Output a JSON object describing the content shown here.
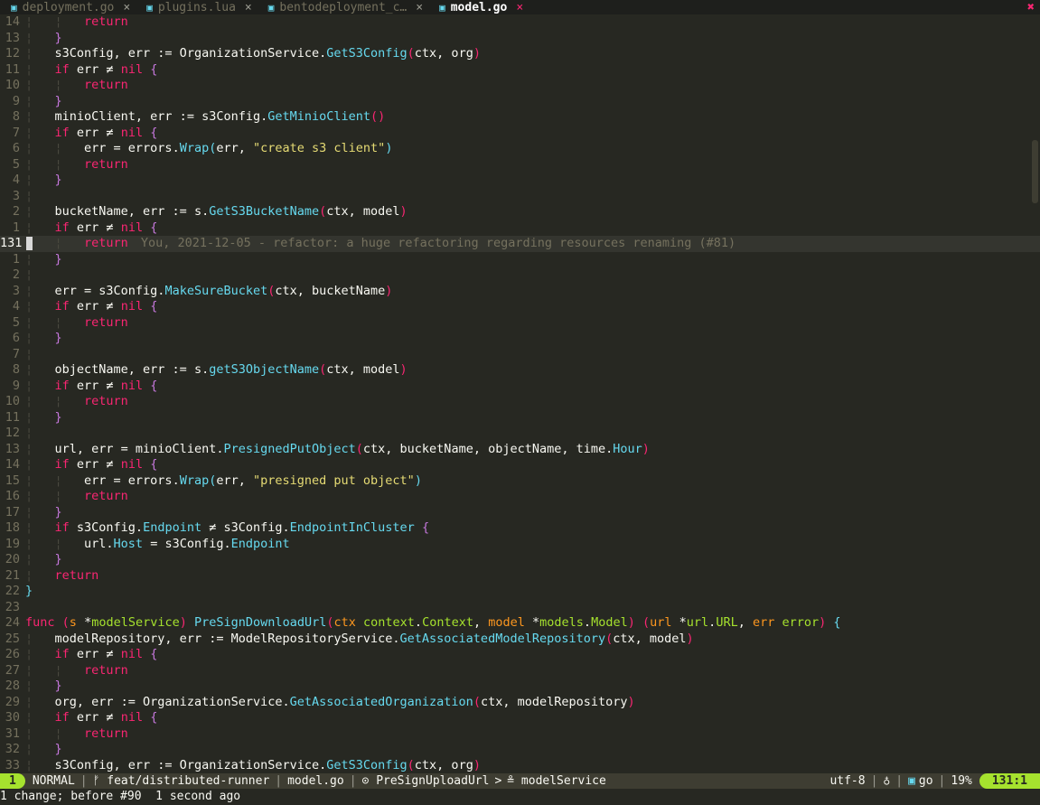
{
  "tabs": [
    {
      "name": "deployment.go",
      "active": false
    },
    {
      "name": "plugins.lua",
      "active": false
    },
    {
      "name": "bentodeployment_c…",
      "active": false
    },
    {
      "name": "model.go",
      "active": true
    }
  ],
  "tab_close_glyph": "×",
  "tabline_close_all": "✖",
  "cursor_line_index": 17,
  "blame_text": "You, 2021-12-05 - refactor: a huge refactoring regarding resources renaming (#81)",
  "lines": [
    {
      "n": "14",
      "t": [
        [
          "ind",
          "¦   ¦   "
        ],
        [
          "kw",
          "return"
        ]
      ]
    },
    {
      "n": "13",
      "t": [
        [
          "ind",
          "¦   "
        ],
        [
          "p2",
          "}"
        ]
      ]
    },
    {
      "n": "12",
      "t": [
        [
          "ind",
          "¦   "
        ],
        [
          "",
          "s3Config, err := OrganizationService."
        ],
        [
          "fn",
          "GetS3Config"
        ],
        [
          "p1",
          "("
        ],
        [
          "",
          "ctx, org"
        ],
        [
          "p1",
          ")"
        ]
      ]
    },
    {
      "n": "11",
      "t": [
        [
          "ind",
          "¦   "
        ],
        [
          "kw",
          "if"
        ],
        [
          "",
          " err ≠ "
        ],
        [
          "kw",
          "nil"
        ],
        [
          "",
          " "
        ],
        [
          "p2",
          "{"
        ]
      ]
    },
    {
      "n": "10",
      "t": [
        [
          "ind",
          "¦   ¦   "
        ],
        [
          "kw",
          "return"
        ]
      ]
    },
    {
      "n": "9",
      "t": [
        [
          "ind",
          "¦   "
        ],
        [
          "p2",
          "}"
        ]
      ]
    },
    {
      "n": "8",
      "t": [
        [
          "ind",
          "¦   "
        ],
        [
          "",
          "minioClient, err := s3Config."
        ],
        [
          "fn",
          "GetMinioClient"
        ],
        [
          "p1",
          "()"
        ]
      ]
    },
    {
      "n": "7",
      "t": [
        [
          "ind",
          "¦   "
        ],
        [
          "kw",
          "if"
        ],
        [
          "",
          " err ≠ "
        ],
        [
          "kw",
          "nil"
        ],
        [
          "",
          " "
        ],
        [
          "p2",
          "{"
        ]
      ]
    },
    {
      "n": "6",
      "t": [
        [
          "ind",
          "¦   ¦   "
        ],
        [
          "",
          "err = errors."
        ],
        [
          "fn",
          "Wrap"
        ],
        [
          "p3",
          "("
        ],
        [
          "",
          "err, "
        ],
        [
          "str",
          "\"create s3 client\""
        ],
        [
          "p3",
          ")"
        ]
      ]
    },
    {
      "n": "5",
      "t": [
        [
          "ind",
          "¦   ¦   "
        ],
        [
          "kw",
          "return"
        ]
      ]
    },
    {
      "n": "4",
      "t": [
        [
          "ind",
          "¦   "
        ],
        [
          "p2",
          "}"
        ]
      ]
    },
    {
      "n": "3",
      "t": [
        [
          "ind",
          "¦   "
        ]
      ]
    },
    {
      "n": "2",
      "t": [
        [
          "ind",
          "¦   "
        ],
        [
          "",
          "bucketName, err := s."
        ],
        [
          "fn",
          "GetS3BucketName"
        ],
        [
          "p1",
          "("
        ],
        [
          "",
          "ctx, model"
        ],
        [
          "p1",
          ")"
        ]
      ]
    },
    {
      "n": "1",
      "t": [
        [
          "ind",
          "¦   "
        ],
        [
          "kw",
          "if"
        ],
        [
          "",
          " err ≠ "
        ],
        [
          "kw",
          "nil"
        ],
        [
          "",
          " "
        ],
        [
          "p2",
          "{"
        ]
      ]
    },
    {
      "n": "131",
      "t": [
        [
          "ind",
          "¦   ¦   "
        ],
        [
          "kw",
          "return"
        ]
      ]
    },
    {
      "n": "1",
      "t": [
        [
          "ind",
          "¦   "
        ],
        [
          "p2",
          "}"
        ]
      ]
    },
    {
      "n": "2",
      "t": [
        [
          "ind",
          "¦   "
        ]
      ]
    },
    {
      "n": "3",
      "t": [
        [
          "ind",
          "¦   "
        ],
        [
          "",
          "err = s3Config."
        ],
        [
          "fn",
          "MakeSureBucket"
        ],
        [
          "p1",
          "("
        ],
        [
          "",
          "ctx, bucketName"
        ],
        [
          "p1",
          ")"
        ]
      ]
    },
    {
      "n": "4",
      "t": [
        [
          "ind",
          "¦   "
        ],
        [
          "kw",
          "if"
        ],
        [
          "",
          " err ≠ "
        ],
        [
          "kw",
          "nil"
        ],
        [
          "",
          " "
        ],
        [
          "p2",
          "{"
        ]
      ]
    },
    {
      "n": "5",
      "t": [
        [
          "ind",
          "¦   ¦   "
        ],
        [
          "kw",
          "return"
        ]
      ]
    },
    {
      "n": "6",
      "t": [
        [
          "ind",
          "¦   "
        ],
        [
          "p2",
          "}"
        ]
      ]
    },
    {
      "n": "7",
      "t": [
        [
          "ind",
          "¦   "
        ]
      ]
    },
    {
      "n": "8",
      "t": [
        [
          "ind",
          "¦   "
        ],
        [
          "",
          "objectName, err := s."
        ],
        [
          "fn",
          "getS3ObjectName"
        ],
        [
          "p1",
          "("
        ],
        [
          "",
          "ctx, model"
        ],
        [
          "p1",
          ")"
        ]
      ]
    },
    {
      "n": "9",
      "t": [
        [
          "ind",
          "¦   "
        ],
        [
          "kw",
          "if"
        ],
        [
          "",
          " err ≠ "
        ],
        [
          "kw",
          "nil"
        ],
        [
          "",
          " "
        ],
        [
          "p2",
          "{"
        ]
      ]
    },
    {
      "n": "10",
      "t": [
        [
          "ind",
          "¦   ¦   "
        ],
        [
          "kw",
          "return"
        ]
      ]
    },
    {
      "n": "11",
      "t": [
        [
          "ind",
          "¦   "
        ],
        [
          "p2",
          "}"
        ]
      ]
    },
    {
      "n": "12",
      "t": [
        [
          "ind",
          "¦   "
        ]
      ]
    },
    {
      "n": "13",
      "t": [
        [
          "ind",
          "¦   "
        ],
        [
          "",
          "url, err = minioClient."
        ],
        [
          "fn",
          "PresignedPutObject"
        ],
        [
          "p1",
          "("
        ],
        [
          "",
          "ctx, bucketName, objectName, time."
        ],
        [
          "fn",
          "Hour"
        ],
        [
          "p1",
          ")"
        ]
      ]
    },
    {
      "n": "14",
      "t": [
        [
          "ind",
          "¦   "
        ],
        [
          "kw",
          "if"
        ],
        [
          "",
          " err ≠ "
        ],
        [
          "kw",
          "nil"
        ],
        [
          "",
          " "
        ],
        [
          "p2",
          "{"
        ]
      ]
    },
    {
      "n": "15",
      "t": [
        [
          "ind",
          "¦   ¦   "
        ],
        [
          "",
          "err = errors."
        ],
        [
          "fn",
          "Wrap"
        ],
        [
          "p3",
          "("
        ],
        [
          "",
          "err, "
        ],
        [
          "str",
          "\"presigned put object\""
        ],
        [
          "p3",
          ")"
        ]
      ]
    },
    {
      "n": "16",
      "t": [
        [
          "ind",
          "¦   ¦   "
        ],
        [
          "kw",
          "return"
        ]
      ]
    },
    {
      "n": "17",
      "t": [
        [
          "ind",
          "¦   "
        ],
        [
          "p2",
          "}"
        ]
      ]
    },
    {
      "n": "18",
      "t": [
        [
          "ind",
          "¦   "
        ],
        [
          "kw",
          "if"
        ],
        [
          "",
          " s3Config."
        ],
        [
          "fn",
          "Endpoint"
        ],
        [
          "",
          " ≠ s3Config."
        ],
        [
          "fn",
          "EndpointInCluster"
        ],
        [
          "",
          " "
        ],
        [
          "p2",
          "{"
        ]
      ]
    },
    {
      "n": "19",
      "t": [
        [
          "ind",
          "¦   ¦   "
        ],
        [
          "",
          "url."
        ],
        [
          "fn",
          "Host"
        ],
        [
          "",
          " = s3Config."
        ],
        [
          "fn",
          "Endpoint"
        ]
      ]
    },
    {
      "n": "20",
      "t": [
        [
          "ind",
          "¦   "
        ],
        [
          "p2",
          "}"
        ]
      ]
    },
    {
      "n": "21",
      "t": [
        [
          "ind",
          "¦   "
        ],
        [
          "kw",
          "return"
        ]
      ]
    },
    {
      "n": "22",
      "t": [
        [
          "p3",
          "}"
        ]
      ]
    },
    {
      "n": "23",
      "t": []
    },
    {
      "n": "24",
      "t": [
        [
          "kw",
          "func"
        ],
        [
          "",
          " "
        ],
        [
          "p1",
          "("
        ],
        [
          "par",
          "s"
        ],
        [
          "",
          " *"
        ],
        [
          "typ",
          "modelService"
        ],
        [
          "p1",
          ")"
        ],
        [
          "",
          " "
        ],
        [
          "fn",
          "PreSignDownloadUrl"
        ],
        [
          "p1",
          "("
        ],
        [
          "par",
          "ctx"
        ],
        [
          "",
          " "
        ],
        [
          "typ",
          "context"
        ],
        [
          "",
          "."
        ],
        [
          "typ",
          "Context"
        ],
        [
          "",
          ", "
        ],
        [
          "par",
          "model"
        ],
        [
          "",
          " *"
        ],
        [
          "typ",
          "models"
        ],
        [
          "",
          "."
        ],
        [
          "typ",
          "Model"
        ],
        [
          "p1",
          ")"
        ],
        [
          "",
          " "
        ],
        [
          "p1",
          "("
        ],
        [
          "par",
          "url"
        ],
        [
          "",
          " *"
        ],
        [
          "typ",
          "url"
        ],
        [
          "",
          "."
        ],
        [
          "typ",
          "URL"
        ],
        [
          "",
          ", "
        ],
        [
          "par",
          "err"
        ],
        [
          "",
          " "
        ],
        [
          "typ",
          "error"
        ],
        [
          "p1",
          ")"
        ],
        [
          "",
          " "
        ],
        [
          "p3",
          "{"
        ]
      ]
    },
    {
      "n": "25",
      "t": [
        [
          "ind",
          "¦   "
        ],
        [
          "",
          "modelRepository, err := ModelRepositoryService."
        ],
        [
          "fn",
          "GetAssociatedModelRepository"
        ],
        [
          "p1",
          "("
        ],
        [
          "",
          "ctx, model"
        ],
        [
          "p1",
          ")"
        ]
      ]
    },
    {
      "n": "26",
      "t": [
        [
          "ind",
          "¦   "
        ],
        [
          "kw",
          "if"
        ],
        [
          "",
          " err ≠ "
        ],
        [
          "kw",
          "nil"
        ],
        [
          "",
          " "
        ],
        [
          "p2",
          "{"
        ]
      ]
    },
    {
      "n": "27",
      "t": [
        [
          "ind",
          "¦   ¦   "
        ],
        [
          "kw",
          "return"
        ]
      ]
    },
    {
      "n": "28",
      "t": [
        [
          "ind",
          "¦   "
        ],
        [
          "p2",
          "}"
        ]
      ]
    },
    {
      "n": "29",
      "t": [
        [
          "ind",
          "¦   "
        ],
        [
          "",
          "org, err := OrganizationService."
        ],
        [
          "fn",
          "GetAssociatedOrganization"
        ],
        [
          "p1",
          "("
        ],
        [
          "",
          "ctx, modelRepository"
        ],
        [
          "p1",
          ")"
        ]
      ]
    },
    {
      "n": "30",
      "t": [
        [
          "ind",
          "¦   "
        ],
        [
          "kw",
          "if"
        ],
        [
          "",
          " err ≠ "
        ],
        [
          "kw",
          "nil"
        ],
        [
          "",
          " "
        ],
        [
          "p2",
          "{"
        ]
      ]
    },
    {
      "n": "31",
      "t": [
        [
          "ind",
          "¦   ¦   "
        ],
        [
          "kw",
          "return"
        ]
      ]
    },
    {
      "n": "32",
      "t": [
        [
          "ind",
          "¦   "
        ],
        [
          "p2",
          "}"
        ]
      ]
    },
    {
      "n": "33",
      "t": [
        [
          "ind",
          "¦   "
        ],
        [
          "",
          "s3Config, err := OrganizationService."
        ],
        [
          "fn",
          "GetS3Config"
        ],
        [
          "p1",
          "("
        ],
        [
          "",
          "ctx, org"
        ],
        [
          "p1",
          ")"
        ]
      ]
    }
  ],
  "statusline": {
    "window_number": "1",
    "mode": "NORMAL",
    "branch": "ᚠ feat/distributed-runner",
    "filename": "model.go",
    "breadcrumb_func": "⊙ PreSignUploadUrl",
    "breadcrumb_sep": ">",
    "breadcrumb_type": "≗ modelService",
    "encoding": "utf-8",
    "fileformat": "♁",
    "filetype": "go",
    "progress": "19%",
    "position": "131:1"
  },
  "cmdline": "1 change; before #90  1 second ago"
}
